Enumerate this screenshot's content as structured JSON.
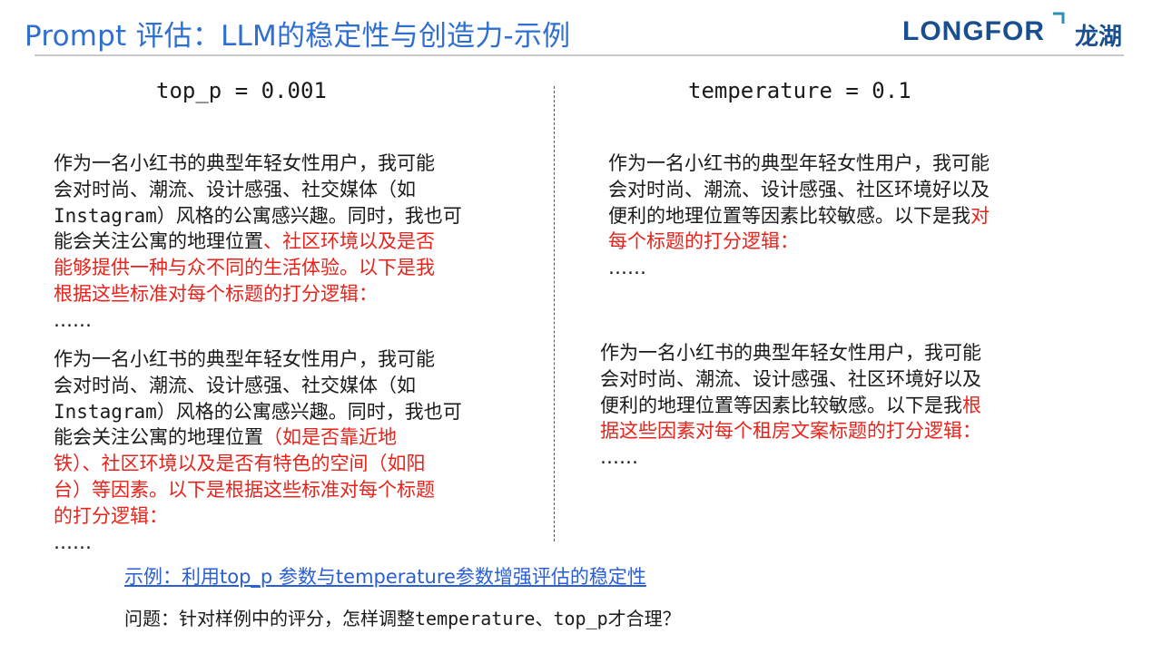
{
  "header": {
    "title": "Prompt 评估：LLM的稳定性与创造力-示例",
    "logo_text": "LONGFOR",
    "logo_cn": "龙湖"
  },
  "left": {
    "param": "top_p = 0.001",
    "block1": {
      "l1": "作为一名小红书的典型年轻女性用户，我可能",
      "l2": "会对时尚、潮流、设计感强、社交媒体（如",
      "l3": "Instagram）风格的公寓感兴趣。同时，我也可",
      "l4a": "能会关注公寓的地理位置",
      "l4b": "、社区环境以及是否",
      "l5": "能够提供一种与众不同的生活体验。以下是我",
      "l6": "根据这些标准对每个标题的打分逻辑：",
      "ellipsis": "……"
    },
    "block2": {
      "l1": "作为一名小红书的典型年轻女性用户，我可能",
      "l2": "会对时尚、潮流、设计感强、社交媒体（如",
      "l3": "Instagram）风格的公寓感兴趣。同时，我也可",
      "l4a": "能会关注公寓的地理位置",
      "l4b": "（如是否靠近地",
      "l5": "铁）、社区环境以及是否有特色的空间（如阳",
      "l6": "台）等因素。以下是根据这些标准对每个标题",
      "l7": "的打分逻辑：",
      "ellipsis": "……"
    }
  },
  "right": {
    "param": "temperature = 0.1",
    "block1": {
      "l1": "作为一名小红书的典型年轻女性用户，我可能",
      "l2": "会对时尚、潮流、设计感强、社区环境好以及",
      "l3a": "便利的地理位置等因素比较敏感。以下是我",
      "l3b": "对",
      "l4": "每个标题的打分逻辑：",
      "ellipsis": "……"
    },
    "block2": {
      "l1": "作为一名小红书的典型年轻女性用户，我可能",
      "l2": "会对时尚、潮流、设计感强、社区环境好以及",
      "l3a": "便利的地理位置等因素比较敏感。以下是我",
      "l3b": "根",
      "l4": "据这些因素对每个租房文案标题的打分逻辑：",
      "ellipsis": "……"
    }
  },
  "footer": {
    "example_link": "示例：利用top_p 参数与temperature参数增强评估的稳定性",
    "question_a": "问题：针对样例中的评分，怎样调整",
    "question_b": "temperature、top_p",
    "question_c": "才合理？"
  },
  "colors": {
    "title": "#2f6fd0",
    "emphasis_red": "#e8231b",
    "link": "#2a5fd4",
    "logo": "#1a4f8f"
  }
}
